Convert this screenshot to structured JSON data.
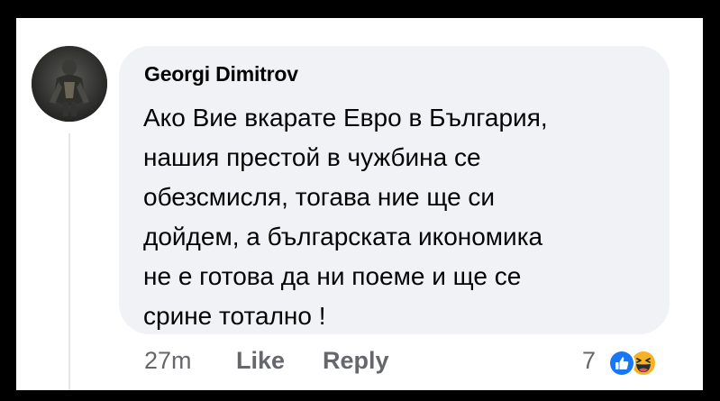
{
  "comment": {
    "author": "Georgi Dimitrov",
    "avatar_icon": "profile-avatar",
    "lines": [
      "Ако Вие вкарате Евро в България,",
      "нашия престой в чужбина се",
      "обезсмисля, тогава ние ще си",
      "дойдем, а българската икономика",
      "не е готова да ни поеме и ще се",
      "срине тотално !"
    ],
    "timestamp": "27m",
    "like_label": "Like",
    "reply_label": "Reply",
    "reaction_count": "7",
    "reaction_icons": [
      "like-reaction-icon",
      "haha-reaction-icon"
    ]
  },
  "colors": {
    "bubble": "#f0f2f5",
    "text": "#050505",
    "secondary": "#65676b",
    "like_blue": "#1877f2",
    "haha_yellow": "#f7b125"
  }
}
